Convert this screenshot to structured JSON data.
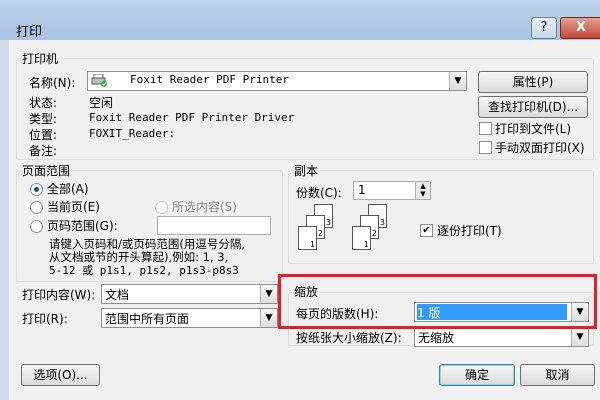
{
  "window": {
    "title": "打印",
    "help": "?",
    "close": "X"
  },
  "printer": {
    "group_title": "打印机",
    "name_label": "名称(N):",
    "name_value": "Foxit Reader PDF Printer",
    "properties_button": "属性(P)",
    "status_label": "状态:",
    "status_value": "空闲",
    "type_label": "类型:",
    "type_value": "Foxit Reader PDF Printer Driver",
    "location_label": "位置:",
    "location_value": "FOXIT_Reader:",
    "comment_label": "备注:",
    "find_printer_button": "查找打印机(D)...",
    "print_to_file": {
      "label": "打印到文件(L)",
      "checked": false
    },
    "manual_duplex": {
      "label": "手动双面打印(X)",
      "checked": false
    }
  },
  "page_range": {
    "group_title": "页面范围",
    "all": {
      "label": "全部(A)",
      "checked": true
    },
    "current": {
      "label": "当前页(E)",
      "checked": false
    },
    "selection": {
      "label": "所选内容(S)",
      "checked": false,
      "enabled": false
    },
    "pages": {
      "label": "页码范围(G):",
      "checked": false,
      "value": ""
    },
    "hint_line1": "请键入页码和/或页码范围(用逗号分隔,",
    "hint_line2": "从文档或节的开头算起),例如: 1, 3,",
    "hint_line3": "5-12 或 p1s1, p1s2, p1s3-p8s3"
  },
  "print_what": {
    "label": "打印内容(W):",
    "value": "文档"
  },
  "print_select": {
    "label": "打印(R):",
    "value": "范围中所有页面"
  },
  "copies": {
    "group_title": "副本",
    "count_label": "份数(C):",
    "count_value": "1",
    "collate": {
      "label": "逐份打印(T)",
      "checked": true
    },
    "page_numbers": [
      "1",
      "2",
      "3"
    ]
  },
  "zoom": {
    "group_title": "缩放",
    "pages_per_sheet_label": "每页的版数(H):",
    "pages_per_sheet_value": "1 版",
    "scale_to_paper_label": "按纸张大小缩放(Z):",
    "scale_to_paper_value": "无缩放"
  },
  "buttons": {
    "options": "选项(O)...",
    "ok": "确定",
    "cancel": "取消"
  },
  "colors": {
    "highlight_border": "#e21f26",
    "selection": "#3399ff"
  }
}
